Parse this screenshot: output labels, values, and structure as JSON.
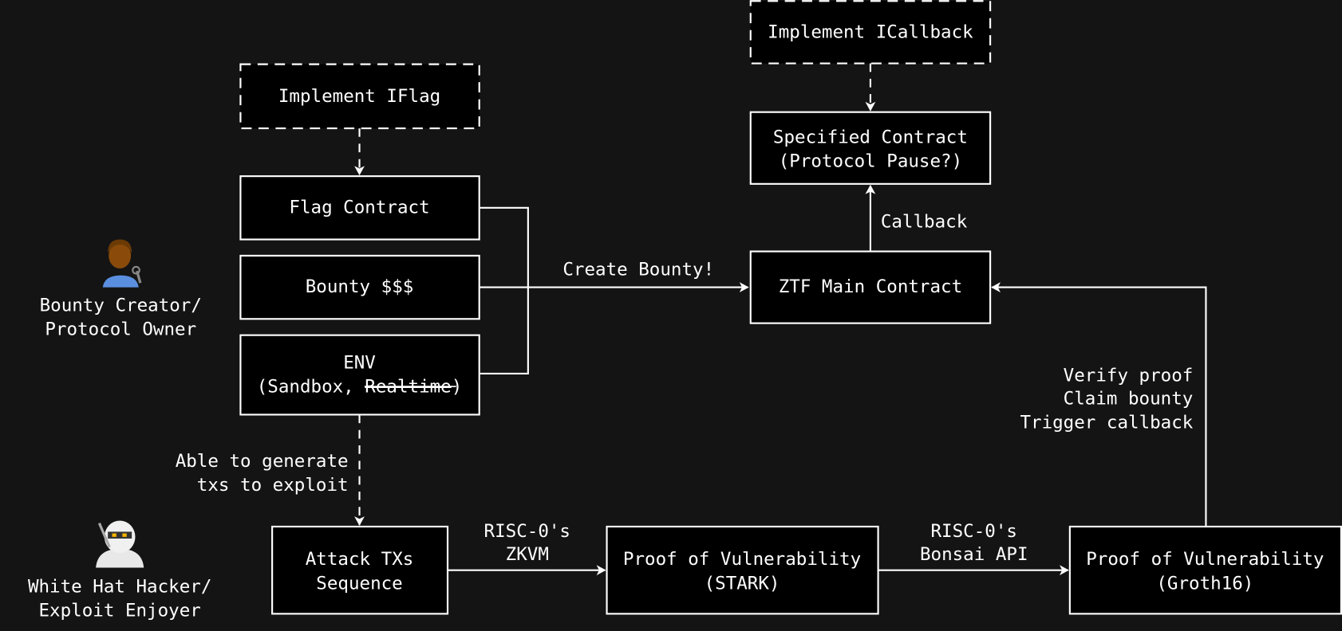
{
  "colors": {
    "background": "#141414",
    "box_fill": "#000000",
    "stroke": "#ffffff"
  },
  "actors": {
    "creator": {
      "icon": "mechanic-emoji-icon",
      "line1": "Bounty Creator/",
      "line2": "Protocol Owner"
    },
    "hacker": {
      "icon": "ninja-emoji-icon",
      "line1": "White Hat Hacker/",
      "line2": "Exploit Enjoyer"
    }
  },
  "nodes": {
    "iflag": "Implement IFlag",
    "flag_contract": "Flag Contract",
    "bounty": "Bounty $$$",
    "env": {
      "line1": "ENV",
      "line2_prefix": "(Sandbox, ",
      "line2_struck": "Realtime",
      "line2_suffix": ")"
    },
    "icallback": "Implement ICallback",
    "specified": {
      "line1": "Specified Contract",
      "line2": "(Protocol Pause?)"
    },
    "ztf_main": "ZTF Main Contract",
    "attack": {
      "line1": "Attack TXs",
      "line2": "Sequence"
    },
    "stark": {
      "line1": "Proof of Vulnerability",
      "line2": "(STARK)"
    },
    "groth": {
      "line1": "Proof of Vulnerability",
      "line2": "(Groth16)"
    }
  },
  "edges": {
    "create_bounty": "Create Bounty!",
    "callback": "Callback",
    "verify": [
      "Verify proof",
      "Claim bounty",
      "Trigger callback"
    ],
    "able": [
      "Able to generate",
      "txs to exploit"
    ],
    "zkvm": [
      "RISC-0's",
      "ZKVM"
    ],
    "bonsai": [
      "RISC-0's",
      "Bonsai API"
    ]
  }
}
